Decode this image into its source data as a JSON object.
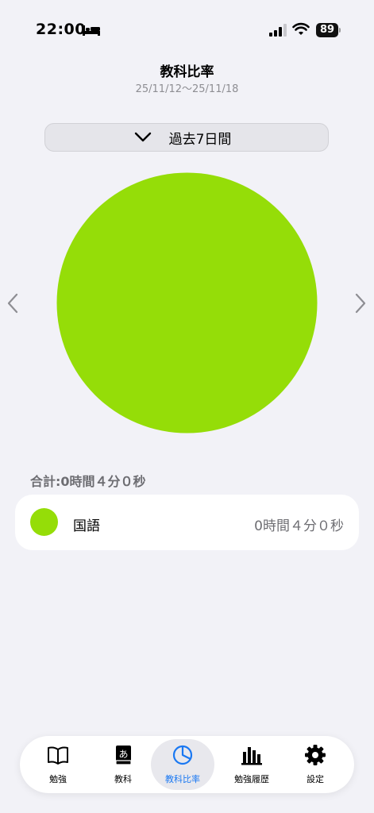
{
  "status": {
    "time": "22:00",
    "battery": "89"
  },
  "header": {
    "title": "教科比率",
    "date_range": "25/11/12～25/11/18"
  },
  "period": {
    "label": "過去7日間"
  },
  "chart_data": {
    "type": "pie",
    "slices": [
      {
        "label": "国語",
        "value": 240,
        "color": "#95dd08"
      }
    ],
    "unit": "seconds"
  },
  "summary": {
    "total": "合計:0時間４分０秒"
  },
  "legend": [
    {
      "name": "国語",
      "time": "0時間４分０秒",
      "color": "#95dd08"
    }
  ],
  "tabs": [
    {
      "label": "勉強",
      "icon": "book-icon"
    },
    {
      "label": "教科",
      "icon": "subject-book-icon"
    },
    {
      "label": "教科比率",
      "icon": "pie-chart-icon",
      "active": true
    },
    {
      "label": "勉強履歴",
      "icon": "bar-chart-icon"
    },
    {
      "label": "設定",
      "icon": "gear-icon"
    }
  ],
  "colors": {
    "accent": "#1a78f2",
    "subject": "#95dd08"
  }
}
